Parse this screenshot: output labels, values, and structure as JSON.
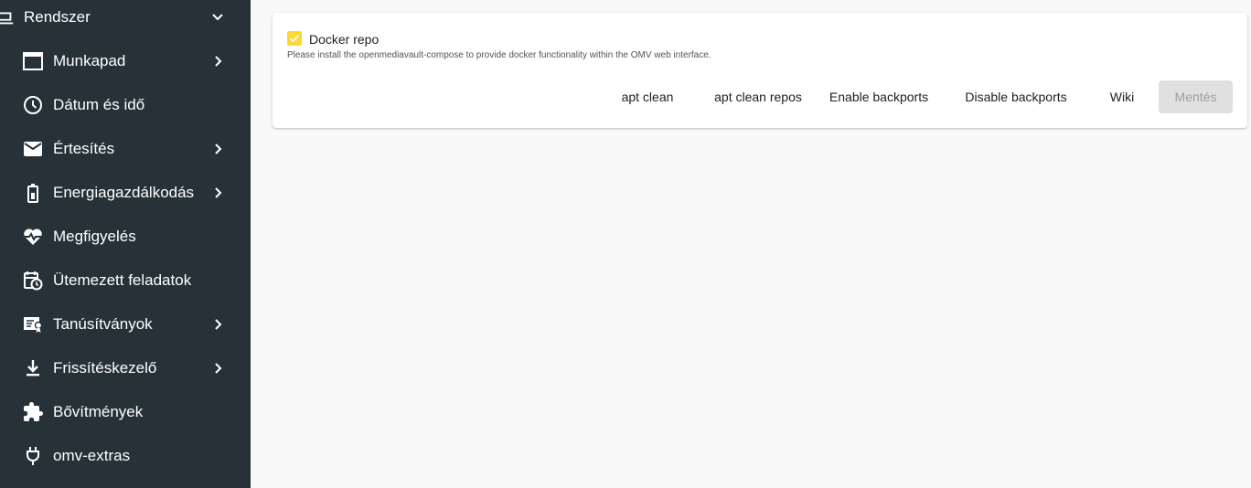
{
  "sidebar": {
    "group": {
      "label": "Rendszer",
      "icon": "laptop-icon",
      "expanded": true
    },
    "items": [
      {
        "label": "Munkapad",
        "icon": "window-icon",
        "has_children": true
      },
      {
        "label": "Dátum és idő",
        "icon": "clock-icon",
        "has_children": false
      },
      {
        "label": "Értesítés",
        "icon": "mail-icon",
        "has_children": true
      },
      {
        "label": "Energiagazdálkodás",
        "icon": "battery-icon",
        "has_children": true
      },
      {
        "label": "Megfigyelés",
        "icon": "heart-pulse-icon",
        "has_children": false
      },
      {
        "label": "Ütemezett feladatok",
        "icon": "calendar-clock-icon",
        "has_children": false
      },
      {
        "label": "Tanúsítványok",
        "icon": "certificate-icon",
        "has_children": true
      },
      {
        "label": "Frissítéskezelő",
        "icon": "download-icon",
        "has_children": true
      },
      {
        "label": "Bővítmények",
        "icon": "puzzle-icon",
        "has_children": false
      },
      {
        "label": "omv-extras",
        "icon": "plug-icon",
        "has_children": false
      }
    ]
  },
  "form": {
    "checkbox": {
      "label": "Docker repo",
      "checked": true
    },
    "hint": "Please install the openmediavault-compose to provide docker functionality within the OMV web interface.",
    "buttons": {
      "apt_clean": "apt clean",
      "apt_clean_repos": "apt clean repos",
      "enable_backports": "Enable backports",
      "disable_backports": "Disable backports",
      "wiki": "Wiki",
      "save": "Mentés"
    }
  },
  "colors": {
    "sidebar_bg": "#263238",
    "accent": "#fdd835",
    "main_bg": "#f9f9f9",
    "disabled_bg": "#e0e0e0"
  }
}
